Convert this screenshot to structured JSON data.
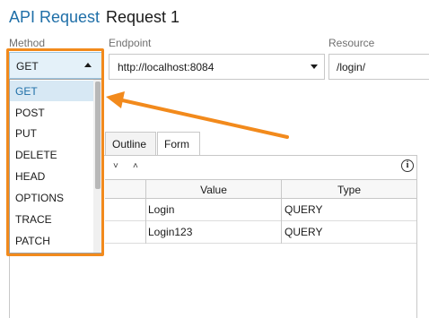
{
  "header": {
    "app_title": "API Request",
    "request_title": "Request 1"
  },
  "labels": {
    "method": "Method",
    "endpoint": "Endpoint",
    "resource": "Resource"
  },
  "method": {
    "selected": "GET",
    "options": [
      "GET",
      "POST",
      "PUT",
      "DELETE",
      "HEAD",
      "OPTIONS",
      "TRACE",
      "PATCH"
    ]
  },
  "endpoint": {
    "value": "http://localhost:8084"
  },
  "resource": {
    "value": "/login/"
  },
  "tabs": [
    "Outline",
    "Form"
  ],
  "table": {
    "columns": [
      "Value",
      "Type"
    ],
    "rows": [
      {
        "value": "Login",
        "type": "QUERY"
      },
      {
        "value": "Login123",
        "type": "QUERY"
      }
    ]
  },
  "annotation": {
    "color": "#f28a1c"
  }
}
